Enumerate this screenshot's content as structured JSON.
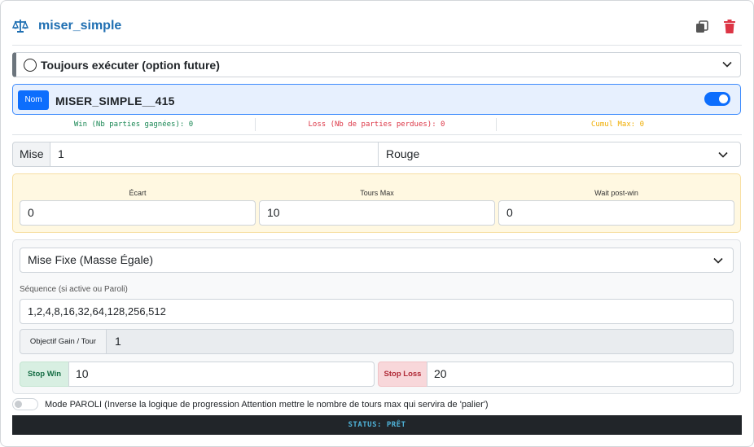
{
  "header": {
    "title": "miser_simple",
    "icons": {
      "title_icon": "balance-scale-icon",
      "copy": "copy-icon",
      "delete": "trash-icon"
    }
  },
  "execution": {
    "selected": "Toujours exécuter (option future)"
  },
  "name_bar": {
    "badge": "Nom",
    "value": "MISER_SIMPLE__415",
    "enabled": true
  },
  "stats": {
    "win": "Win (Nb parties gagnées): 0",
    "loss": "Loss (Nb de parties perdues): 0",
    "cumul": "Cumul Max: 0"
  },
  "bet": {
    "label": "Mise",
    "value": "1",
    "color_selected": "Rouge"
  },
  "params": {
    "ecart_label": "Écart",
    "ecart_value": "0",
    "tours_max_label": "Tours Max",
    "tours_max_value": "10",
    "wait_label": "Wait post-win",
    "wait_value": "0"
  },
  "strategy": {
    "selected": "Mise Fixe (Masse Égale)",
    "sequence_label": "Séquence (si active ou Paroli)",
    "sequence_value": "1,2,4,8,16,32,64,128,256,512",
    "objective_label": "Objectif Gain / Tour",
    "objective_value": "1",
    "stop_win_label": "Stop Win",
    "stop_win_value": "10",
    "stop_loss_label": "Stop Loss",
    "stop_loss_value": "20"
  },
  "paroli": {
    "enabled": false,
    "label": "Mode PAROLI (Inverse la logique de progression Attention mettre le nombre de tours max qui servira de 'palier')"
  },
  "status": {
    "text": "STATUS: PRÊT"
  },
  "colors": {
    "accent": "#0d6efd",
    "title": "#1f6fb2",
    "win": "#198754",
    "loss": "#dc3545",
    "cumul": "#f0ad00",
    "status_bg": "#212529",
    "status_text": "#4fb3d9"
  }
}
